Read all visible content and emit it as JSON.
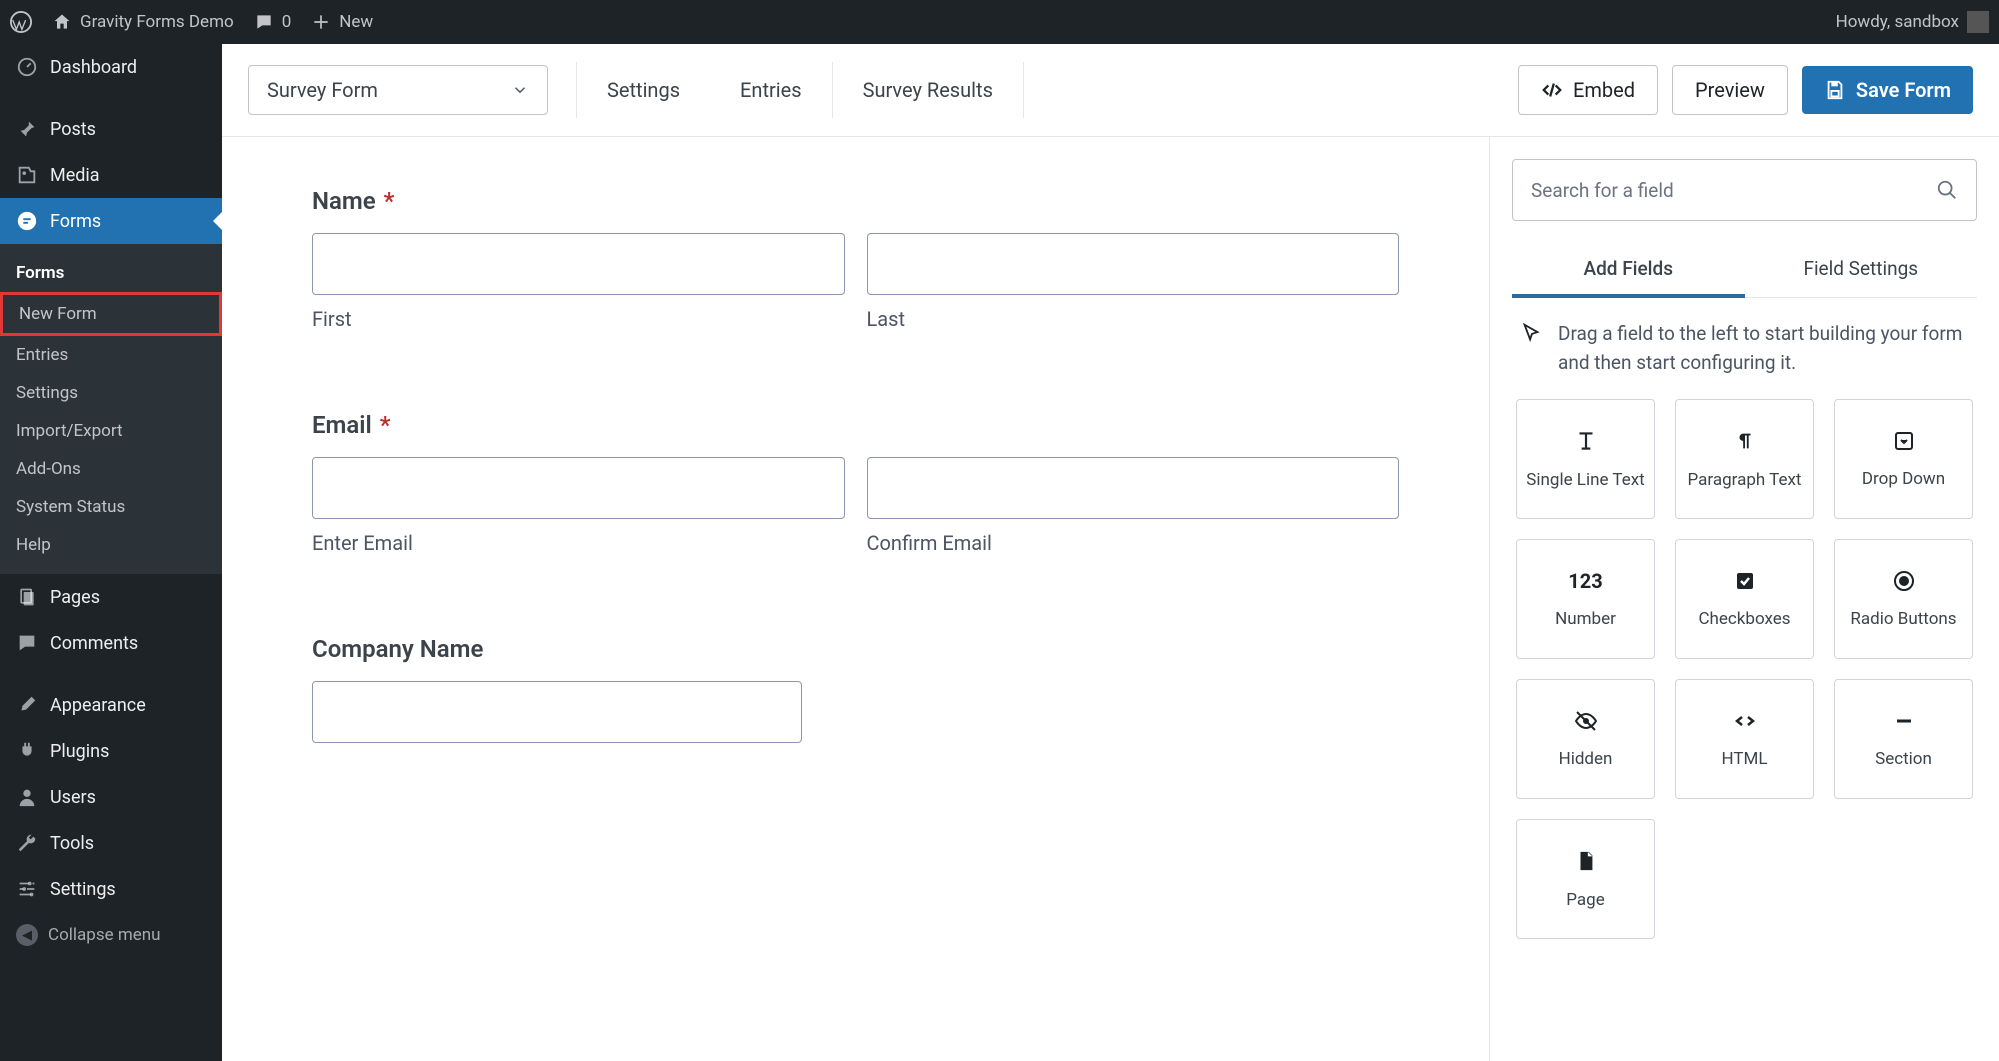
{
  "adminBar": {
    "siteName": "Gravity Forms Demo",
    "commentsCount": "0",
    "newLabel": "New",
    "greeting": "Howdy, sandbox"
  },
  "sidebar": {
    "dashboard": "Dashboard",
    "posts": "Posts",
    "media": "Media",
    "forms": "Forms",
    "sub": {
      "forms": "Forms",
      "newForm": "New Form",
      "entries": "Entries",
      "settings": "Settings",
      "importExport": "Import/Export",
      "addOns": "Add-Ons",
      "systemStatus": "System Status",
      "help": "Help"
    },
    "pages": "Pages",
    "comments": "Comments",
    "appearance": "Appearance",
    "plugins": "Plugins",
    "users": "Users",
    "tools": "Tools",
    "settings": "Settings",
    "collapse": "Collapse menu"
  },
  "topbar": {
    "formName": "Survey Form",
    "tabs": {
      "settings": "Settings",
      "entries": "Entries",
      "results": "Survey Results"
    },
    "embed": "Embed",
    "preview": "Preview",
    "save": "Save Form"
  },
  "canvas": {
    "name": {
      "label": "Name",
      "first": "First",
      "last": "Last"
    },
    "email": {
      "label": "Email",
      "enter": "Enter Email",
      "confirm": "Confirm Email"
    },
    "company": {
      "label": "Company Name"
    }
  },
  "panel": {
    "searchPlaceholder": "Search for a field",
    "tabs": {
      "add": "Add Fields",
      "settings": "Field Settings"
    },
    "hint": "Drag a field to the left to start building your form and then start configuring it.",
    "fields": {
      "singleLine": "Single Line Text",
      "paragraph": "Paragraph Text",
      "dropDown": "Drop Down",
      "number": "Number",
      "checkboxes": "Checkboxes",
      "radio": "Radio Buttons",
      "hidden": "Hidden",
      "html": "HTML",
      "section": "Section",
      "page": "Page"
    }
  }
}
